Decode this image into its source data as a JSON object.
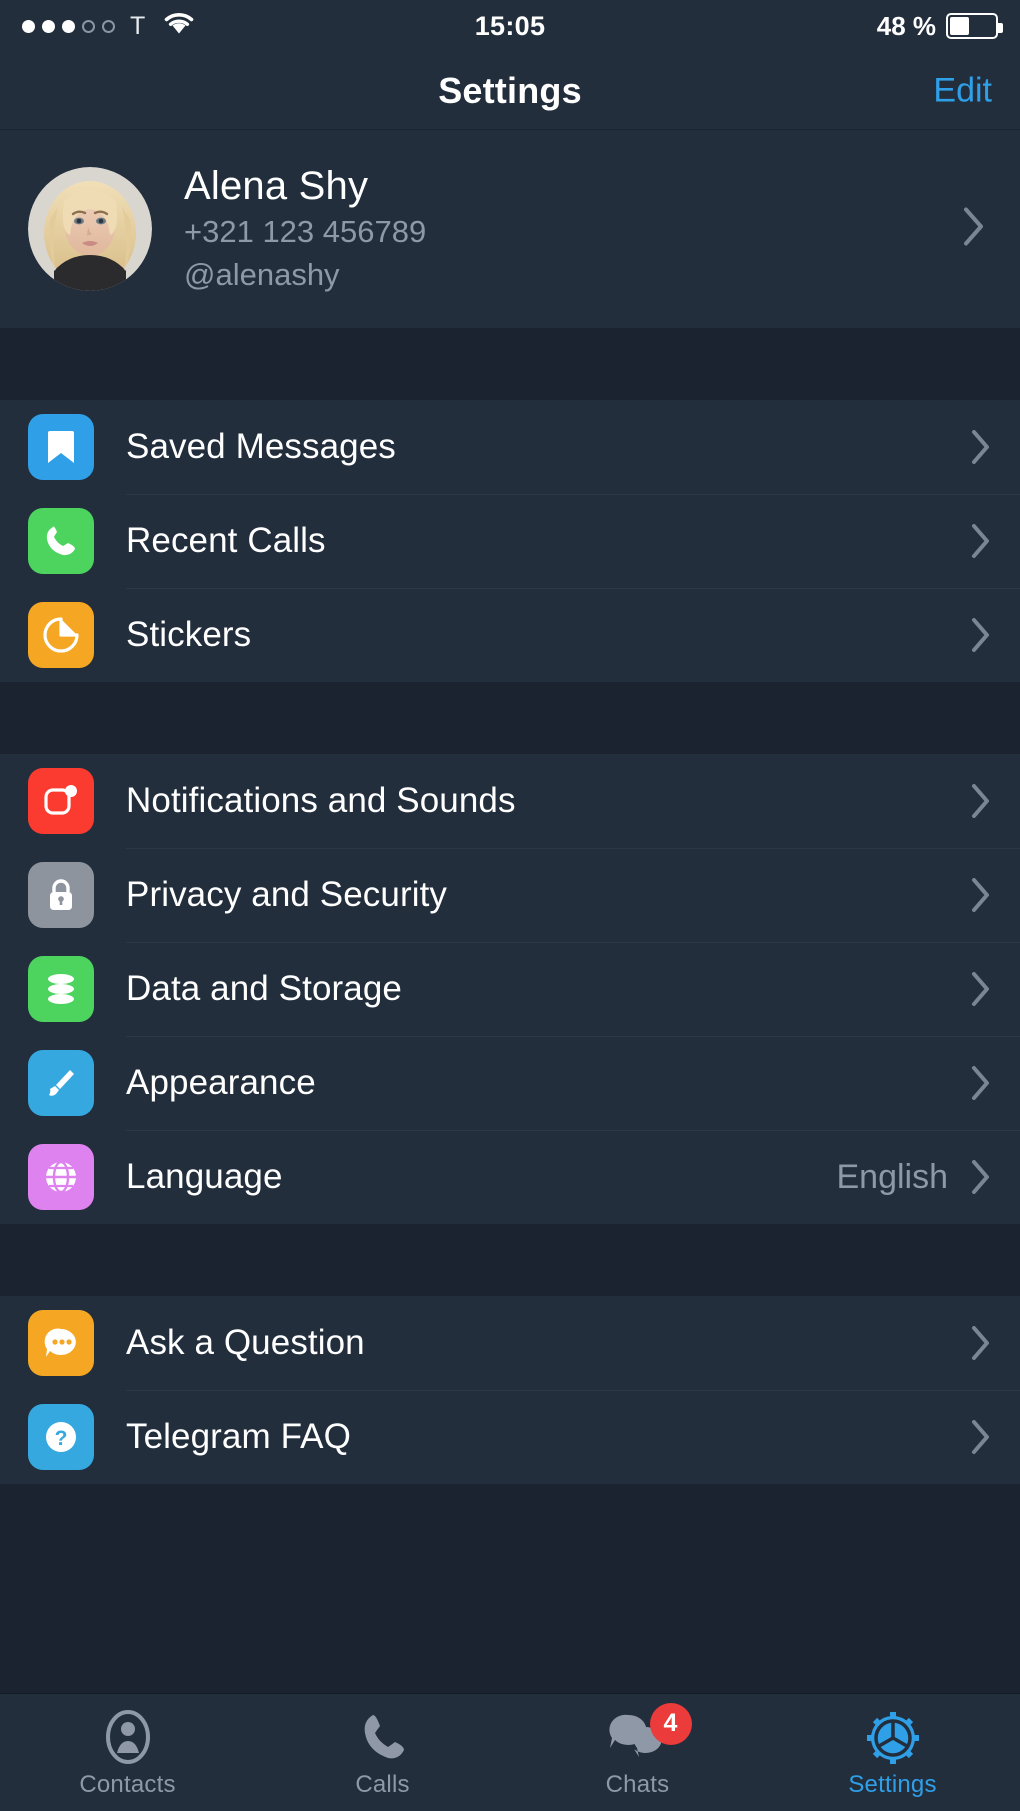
{
  "status_bar": {
    "signal_dots_filled": 3,
    "signal_dots_total": 5,
    "carrier": "T",
    "wifi_icon": "wifi-icon",
    "time": "15:05",
    "battery_text": "48 %",
    "battery_percent": 48
  },
  "nav": {
    "title": "Settings",
    "edit_label": "Edit"
  },
  "profile": {
    "avatar_icon": "user-avatar-photo",
    "name": "Alena Shy",
    "phone": "+321 123 456789",
    "username": "@alenashy"
  },
  "groups": [
    {
      "rows": [
        {
          "label": "Saved Messages",
          "icon": "bookmark-icon",
          "icon_color": "#2f9fe8",
          "value": ""
        },
        {
          "label": "Recent Calls",
          "icon": "phone-icon",
          "icon_color": "#4cd45e",
          "value": ""
        },
        {
          "label": "Stickers",
          "icon": "sticker-icon",
          "icon_color": "#f5a623",
          "value": ""
        }
      ]
    },
    {
      "rows": [
        {
          "label": "Notifications and Sounds",
          "icon": "notification-icon",
          "icon_color": "#fb3b30",
          "value": ""
        },
        {
          "label": "Privacy and Security",
          "icon": "lock-icon",
          "icon_color": "#8e949d",
          "value": ""
        },
        {
          "label": "Data and Storage",
          "icon": "database-icon",
          "icon_color": "#4cd45e",
          "value": ""
        },
        {
          "label": "Appearance",
          "icon": "paintbrush-icon",
          "icon_color": "#35a8e0",
          "value": ""
        },
        {
          "label": "Language",
          "icon": "globe-icon",
          "icon_color": "#dd82ef",
          "value": "English"
        }
      ]
    },
    {
      "rows": [
        {
          "label": "Ask a Question",
          "icon": "chat-bubble-icon",
          "icon_color": "#f5a623",
          "value": ""
        },
        {
          "label": "Telegram FAQ",
          "icon": "question-mark-icon",
          "icon_color": "#35a8e0",
          "value": ""
        }
      ]
    }
  ],
  "tabbar": {
    "items": [
      {
        "label": "Contacts",
        "icon": "contacts-icon",
        "active": false,
        "badge": ""
      },
      {
        "label": "Calls",
        "icon": "phone-icon",
        "active": false,
        "badge": ""
      },
      {
        "label": "Chats",
        "icon": "chats-icon",
        "active": false,
        "badge": "4"
      },
      {
        "label": "Settings",
        "icon": "gear-icon",
        "active": true,
        "badge": ""
      }
    ]
  },
  "colors": {
    "background": "#1b2330",
    "row_background": "#222e3c",
    "accent": "#2f9fe8",
    "secondary_text": "#8e98a6",
    "badge": "#eb3b3b"
  }
}
